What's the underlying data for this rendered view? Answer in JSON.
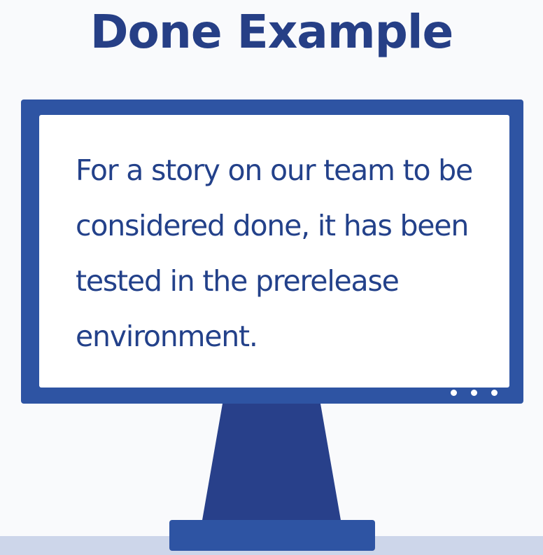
{
  "slide": {
    "title": "Done Example",
    "screen_text": "For a story on our team to be considered done, it has been tested in the prerelease environment."
  },
  "colors": {
    "title": "#263f86",
    "monitor_frame": "#2e54a3",
    "monitor_stand": "#28408a",
    "screen_background": "#ffffff",
    "screen_text": "#23418a",
    "floor": "#cdd6ea",
    "page_background": "#f9fafc"
  }
}
